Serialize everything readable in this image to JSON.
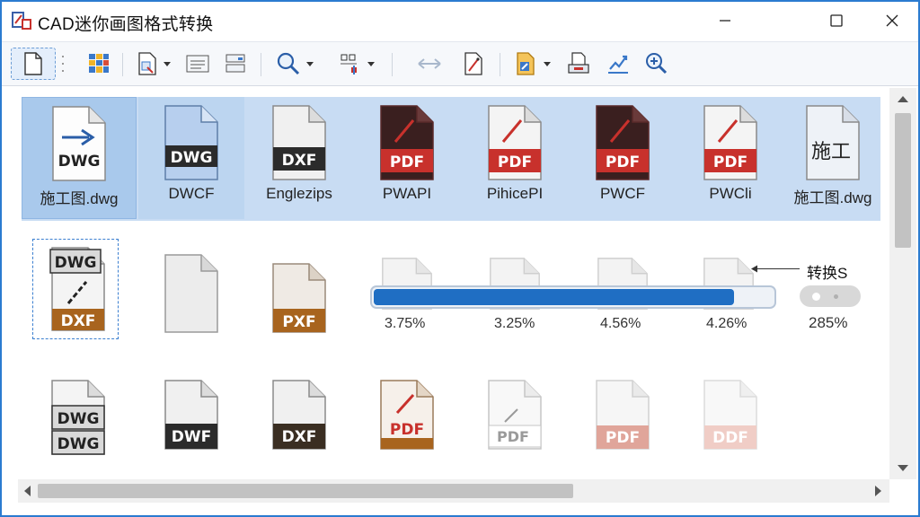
{
  "window": {
    "title": "CAD迷你画图格式转换"
  },
  "toolbar": {
    "buttons": [
      "new-file",
      "layers",
      "page-export",
      "properties",
      "layout",
      "zoom",
      "block",
      "measure",
      "edit",
      "batch",
      "print",
      "annotate",
      "zoom-fit"
    ]
  },
  "row1": {
    "items": [
      {
        "badge": "DWG",
        "label": "施工图.dwg"
      },
      {
        "badge": "DWG",
        "label": "DWCF"
      },
      {
        "badge": "DXF",
        "label": "Englezips"
      },
      {
        "badge": "PDF",
        "label": "PWAPI"
      },
      {
        "badge": "PDF",
        "label": "PihicePI"
      },
      {
        "badge": "PDF",
        "label": "PWCF"
      },
      {
        "badge": "PDF",
        "label": "PWCli"
      },
      {
        "badge": "施工",
        "label": "施工图.dwg"
      }
    ]
  },
  "row2": {
    "items": [
      {
        "badge_top": "DWG",
        "badge_bottom": "DXF"
      },
      {
        "badge": ""
      },
      {
        "badge": "PXF"
      },
      {
        "pct": "3.75%"
      },
      {
        "pct": "3.25%"
      },
      {
        "pct": "4.56%"
      },
      {
        "pct": "4.26%"
      }
    ],
    "progress": 0.895,
    "callout": "转换S",
    "toggle_pct": "285%"
  },
  "row3": {
    "items": [
      {
        "badge_top": "DWG",
        "badge_bottom": "DWG"
      },
      {
        "badge": "DWF"
      },
      {
        "badge": "DXF"
      },
      {
        "badge": "PDF"
      },
      {
        "badge": "PDF"
      },
      {
        "badge": "PDF"
      },
      {
        "badge": "DDF"
      }
    ]
  },
  "colors": {
    "accent": "#1f6ec3",
    "selection": "#c8dcf3",
    "pdf_red": "#c8312c",
    "dxf_brown": "#a8641e",
    "dwg_dark": "#2b2b2b"
  }
}
